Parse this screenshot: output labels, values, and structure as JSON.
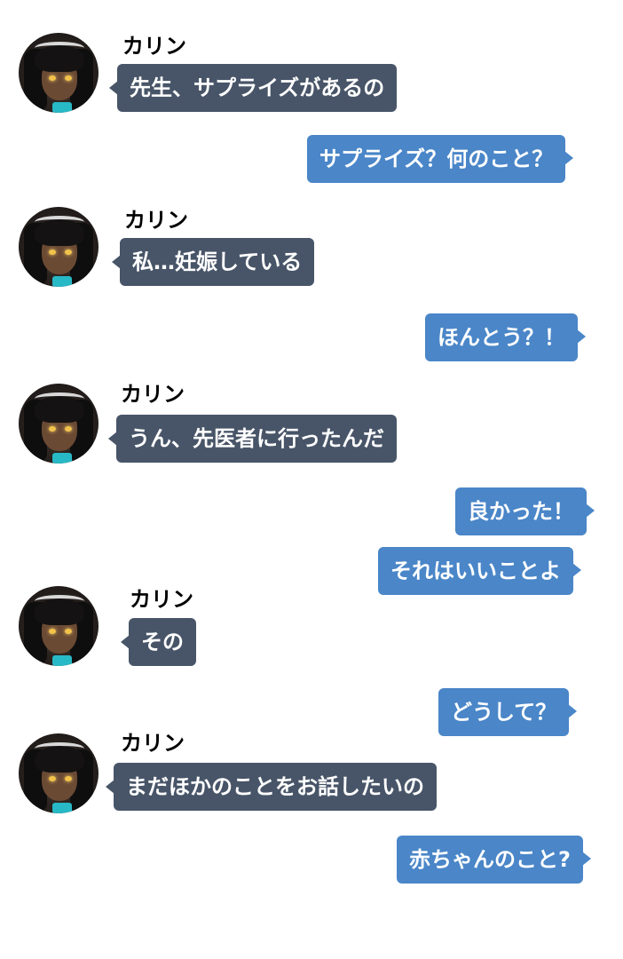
{
  "app": {
    "accent_incoming": "#485568",
    "accent_outgoing": "#4a86c8"
  },
  "speaker": {
    "name": "カリン",
    "avatar_icon": "karin-avatar-icon"
  },
  "messages": [
    {
      "side": "left",
      "text": "先生、サプライズがあるの"
    },
    {
      "side": "right",
      "text": "サプライズ？何のこと？"
    },
    {
      "side": "left",
      "text": "私…妊娠している"
    },
    {
      "side": "right",
      "text": "ほんとう？！"
    },
    {
      "side": "left",
      "text": "うん、先医者に行ったんだ"
    },
    {
      "side": "right",
      "text": "良かった！"
    },
    {
      "side": "right",
      "text": "それはいいことよ"
    },
    {
      "side": "left",
      "text": "その"
    },
    {
      "side": "right",
      "text": "どうして？"
    },
    {
      "side": "left",
      "text": "まだほかのことをお話したいの"
    },
    {
      "side": "right",
      "text": "赤ちゃんのこと?"
    }
  ]
}
